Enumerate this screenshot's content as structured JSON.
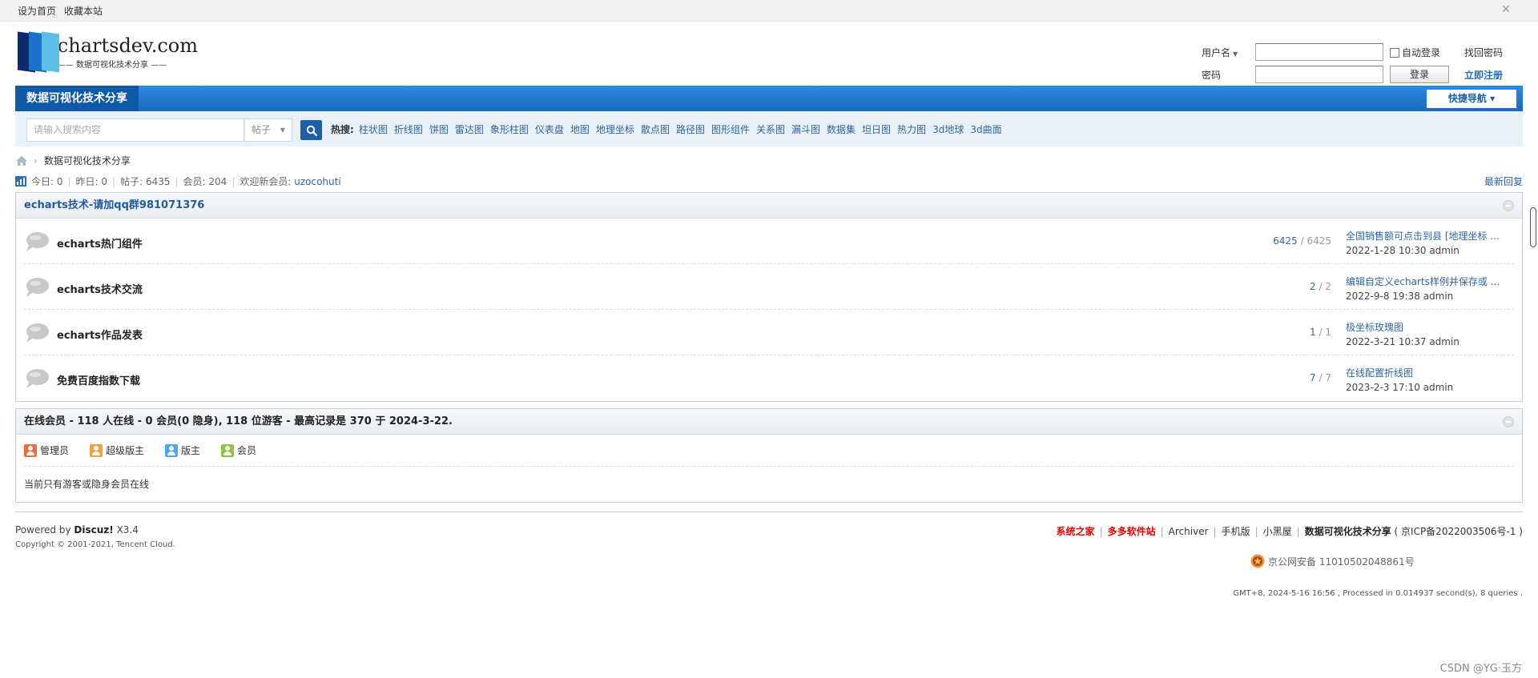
{
  "topbar": {
    "set_home": "设为首页",
    "bookmark": "收藏本站"
  },
  "logo": {
    "brand": "chartsdev.com",
    "slogan": "—— 数据可视化技术分享 ——"
  },
  "login": {
    "username_label": "用户名",
    "password_label": "密码",
    "auto_login": "自动登录",
    "login_button": "登录",
    "find_password": "找回密码",
    "register": "立即注册"
  },
  "nav": {
    "home": "数据可视化技术分享",
    "quick_nav": "快捷导航 ▾"
  },
  "search": {
    "placeholder": "请输入搜索内容",
    "type": "帖子",
    "hot_label": "热搜:",
    "hot": [
      "柱状图",
      "折线图",
      "饼图",
      "雷达图",
      "象形柱图",
      "仪表盘",
      "地图",
      "地理坐标",
      "散点图",
      "路径图",
      "图形组件",
      "关系图",
      "漏斗图",
      "数据集",
      "坦日图",
      "热力图",
      "3d地球",
      "3d曲面"
    ]
  },
  "breadcrumb": {
    "current": "数据可视化技术分享"
  },
  "stats": {
    "today": "今日: 0",
    "yesterday": "昨日: 0",
    "posts": "帖子: 6435",
    "members": "会员: 204",
    "welcome": "欢迎新会员:",
    "new_member": "uzocohuti",
    "latest_reply": "最新回复"
  },
  "forum": {
    "header": "echarts技术-请加qq群981071376",
    "rows": [
      {
        "name": "echarts热门组件",
        "threads": "6425",
        "posts": "6425",
        "last_title": "全国销售额可点击到县 [地理坐标 ...",
        "last_meta": "2022-1-28 10:30 admin"
      },
      {
        "name": "echarts技术交流",
        "threads": "2",
        "posts": "2",
        "last_title": "编辑自定义echarts样例并保存或 ...",
        "last_meta": "2022-9-8 19:38 admin"
      },
      {
        "name": "echarts作品发表",
        "threads": "1",
        "posts": "1",
        "last_title": "极坐标玫瑰图",
        "last_meta": "2022-3-21 10:37 admin"
      },
      {
        "name": "免费百度指数下载",
        "threads": "7",
        "posts": "7",
        "last_title": "在线配置折线图",
        "last_meta": "2023-2-3 17:10 admin"
      }
    ]
  },
  "online": {
    "header": "在线会员 - 118 人在线 - 0 会员(0 隐身), 118 位游客 - 最高记录是 370 于 2024-3-22.",
    "legend": [
      {
        "label": "管理员",
        "color": "#f06b3a"
      },
      {
        "label": "超级版主",
        "color": "#f0a23a"
      },
      {
        "label": "版主",
        "color": "#49a9e6"
      },
      {
        "label": "会员",
        "color": "#8cc63f"
      }
    ],
    "note": "当前只有游客或隐身会员在线"
  },
  "footer": {
    "powered_prefix": "Powered by",
    "powered_brand": "Discuz!",
    "powered_version": "X3.4",
    "copyright": "Copyright © 2001-2021, Tencent Cloud.",
    "link_syshome": "系统之家",
    "link_duoduo": "多多软件站",
    "link_archiver": "Archiver",
    "link_mobile": "手机版",
    "link_blackroom": "小黑屋",
    "site_name": "数据可视化技术分享",
    "icp": "( 京ICP备2022003506号-1 )",
    "beian": "京公网安备 11010502048861号",
    "proc_info": "GMT+8, 2024-5-16 16:56 , Processed in 0.014937 second(s), 8 queries ."
  },
  "watermark": "CSDN @YG·玉方",
  "icons": {
    "close": "close-icon",
    "home": "home-icon",
    "search": "search-icon",
    "stats": "bar-chart-icon",
    "forum": "speech-bubble-icon",
    "emblem": "police-emblem-icon"
  }
}
